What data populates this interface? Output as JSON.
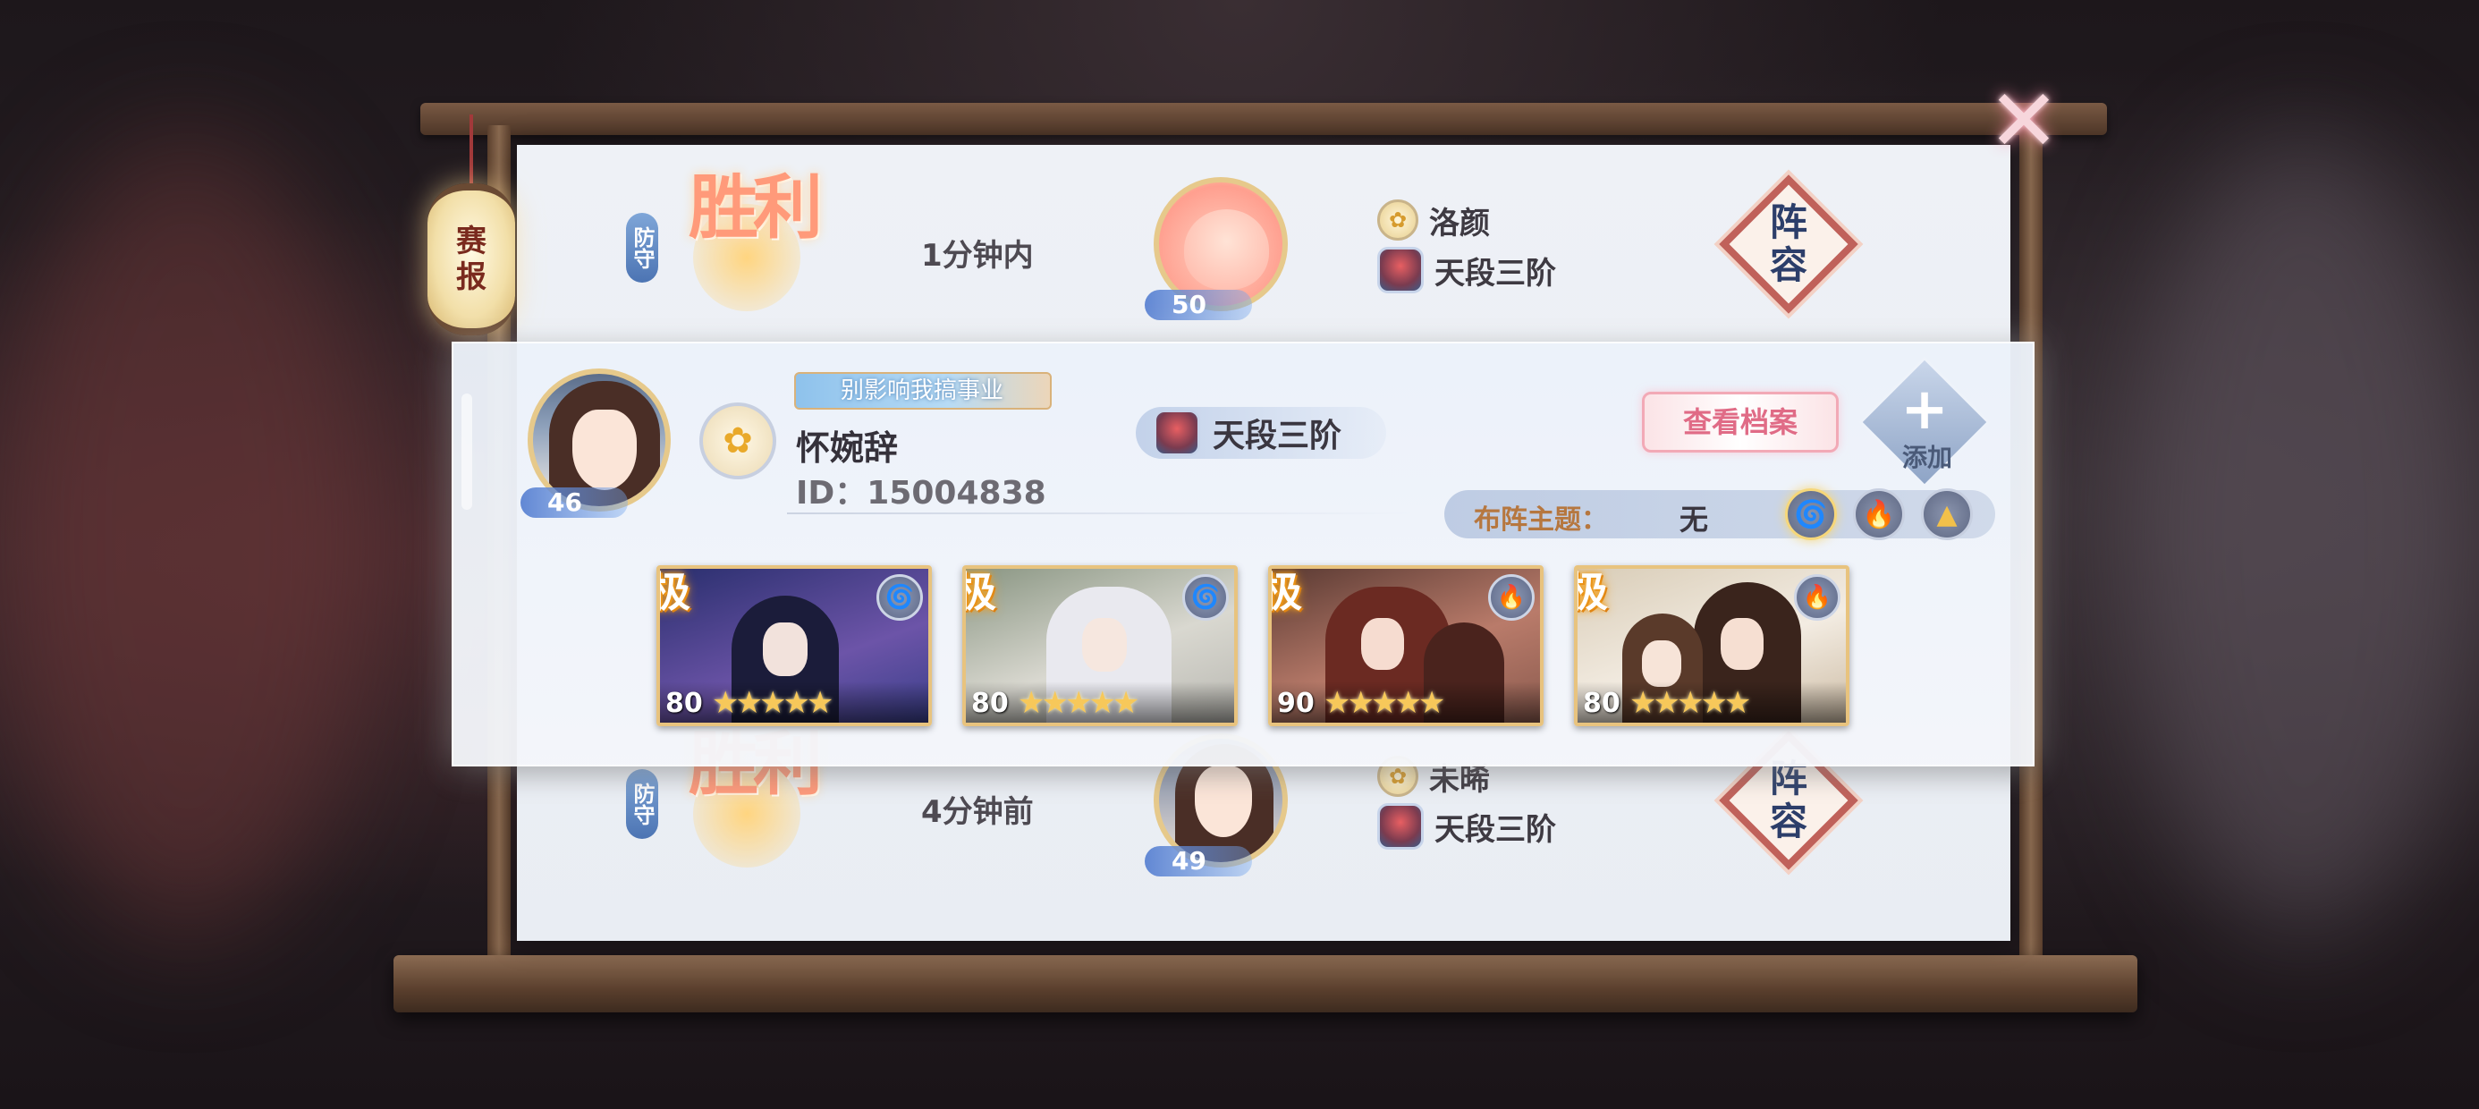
{
  "lantern": {
    "line1": "赛",
    "line2": "报"
  },
  "close": {
    "icon": "close-x-icon",
    "glyph": "✕"
  },
  "battles": [
    {
      "side": "防守",
      "result": "胜利",
      "time": "1分钟内",
      "level": "50",
      "opponent_name": "洛颜",
      "opponent_rank": "天段三阶",
      "lineup_label": [
        "阵",
        "容"
      ]
    },
    {
      "side": "防守",
      "result": "胜利",
      "time": "4分钟前",
      "level": "49",
      "opponent_name": "未晞",
      "opponent_rank": "天段三阶",
      "lineup_label": [
        "阵",
        "容"
      ]
    }
  ],
  "detail": {
    "avatar_level": "46",
    "title_badge": "别影响我搞事业",
    "name": "怀婉辞",
    "id_text": "ID：15004838",
    "rank": "天段三阶",
    "view_profile_label": "查看档案",
    "add_label": "添加",
    "theme_label": "布阵主题：",
    "theme_value": "无",
    "theme_elements": [
      {
        "icon": "wind-icon",
        "glyph": "🌀",
        "color": "#8fa0bf"
      },
      {
        "icon": "fire-icon",
        "glyph": "🔥",
        "color": "#e7642a"
      },
      {
        "icon": "earth-icon",
        "glyph": "▲",
        "color": "#e7b33a"
      }
    ]
  },
  "cards": [
    {
      "grade": "极",
      "level": "80",
      "stars": 5,
      "element": "wind-icon",
      "element_glyph": "🌀",
      "bg1": "#2a2f6e",
      "bg2": "#6c54a8",
      "fig": "#1b1c3a"
    },
    {
      "grade": "极",
      "level": "80",
      "stars": 5,
      "element": "wind-icon",
      "element_glyph": "🌀",
      "bg1": "#8a9683",
      "bg2": "#d9d8d0",
      "fig": "#e9e9ef"
    },
    {
      "grade": "极",
      "level": "90",
      "stars": 5,
      "element": "fire-icon",
      "element_glyph": "🔥",
      "bg1": "#5a3a33",
      "bg2": "#b97b6a",
      "fig": "#6b2a22"
    },
    {
      "grade": "极",
      "level": "80",
      "stars": 5,
      "element": "fire-icon",
      "element_glyph": "🔥",
      "bg1": "#d9cdb8",
      "bg2": "#f3ece2",
      "fig": "#3a241c"
    }
  ],
  "colors": {
    "accent_pink": "#e06b86",
    "gold": "#e8c37e",
    "rank_text": "#3a3640"
  }
}
